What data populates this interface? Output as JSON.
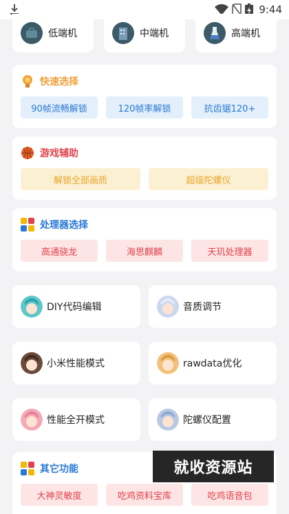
{
  "status_bar": {
    "time": "9:44"
  },
  "devices": [
    {
      "label": "低端机",
      "icon": "briefcase-icon"
    },
    {
      "label": "中端机",
      "icon": "building-icon"
    },
    {
      "label": "高端机",
      "icon": "flask-icon"
    }
  ],
  "quick_select": {
    "title": "快速选择",
    "icon": "lightbulb-icon",
    "buttons": [
      "90帧流畅解锁",
      "120帧率解锁",
      "抗齿锯120+"
    ]
  },
  "game_assist": {
    "title": "游戏辅助",
    "icon": "basketball-icon",
    "buttons": [
      "解锁全部画质",
      "超级陀螺仪"
    ]
  },
  "processor": {
    "title": "处理器选择",
    "icon": "colorful-squares-icon",
    "buttons": [
      "高通骁龙",
      "海思麒麟",
      "天玑处理器"
    ]
  },
  "tools": [
    {
      "label": "DIY代码编辑"
    },
    {
      "label": "音质调节"
    },
    {
      "label": "小米性能模式"
    },
    {
      "label": "rawdata优化"
    },
    {
      "label": "性能全开模式"
    },
    {
      "label": "陀螺仪配置"
    }
  ],
  "other": {
    "title": "其它功能",
    "icon": "colorful-squares-icon",
    "buttons": [
      "大神灵敏度",
      "吃鸡资料宝库",
      "吃鸡语音包"
    ]
  },
  "watermark": "就收资源站",
  "colors": {
    "blue": "#2a78d4",
    "orange": "#e7a52a",
    "red": "#e0434b",
    "background": "#f3f3f5"
  }
}
